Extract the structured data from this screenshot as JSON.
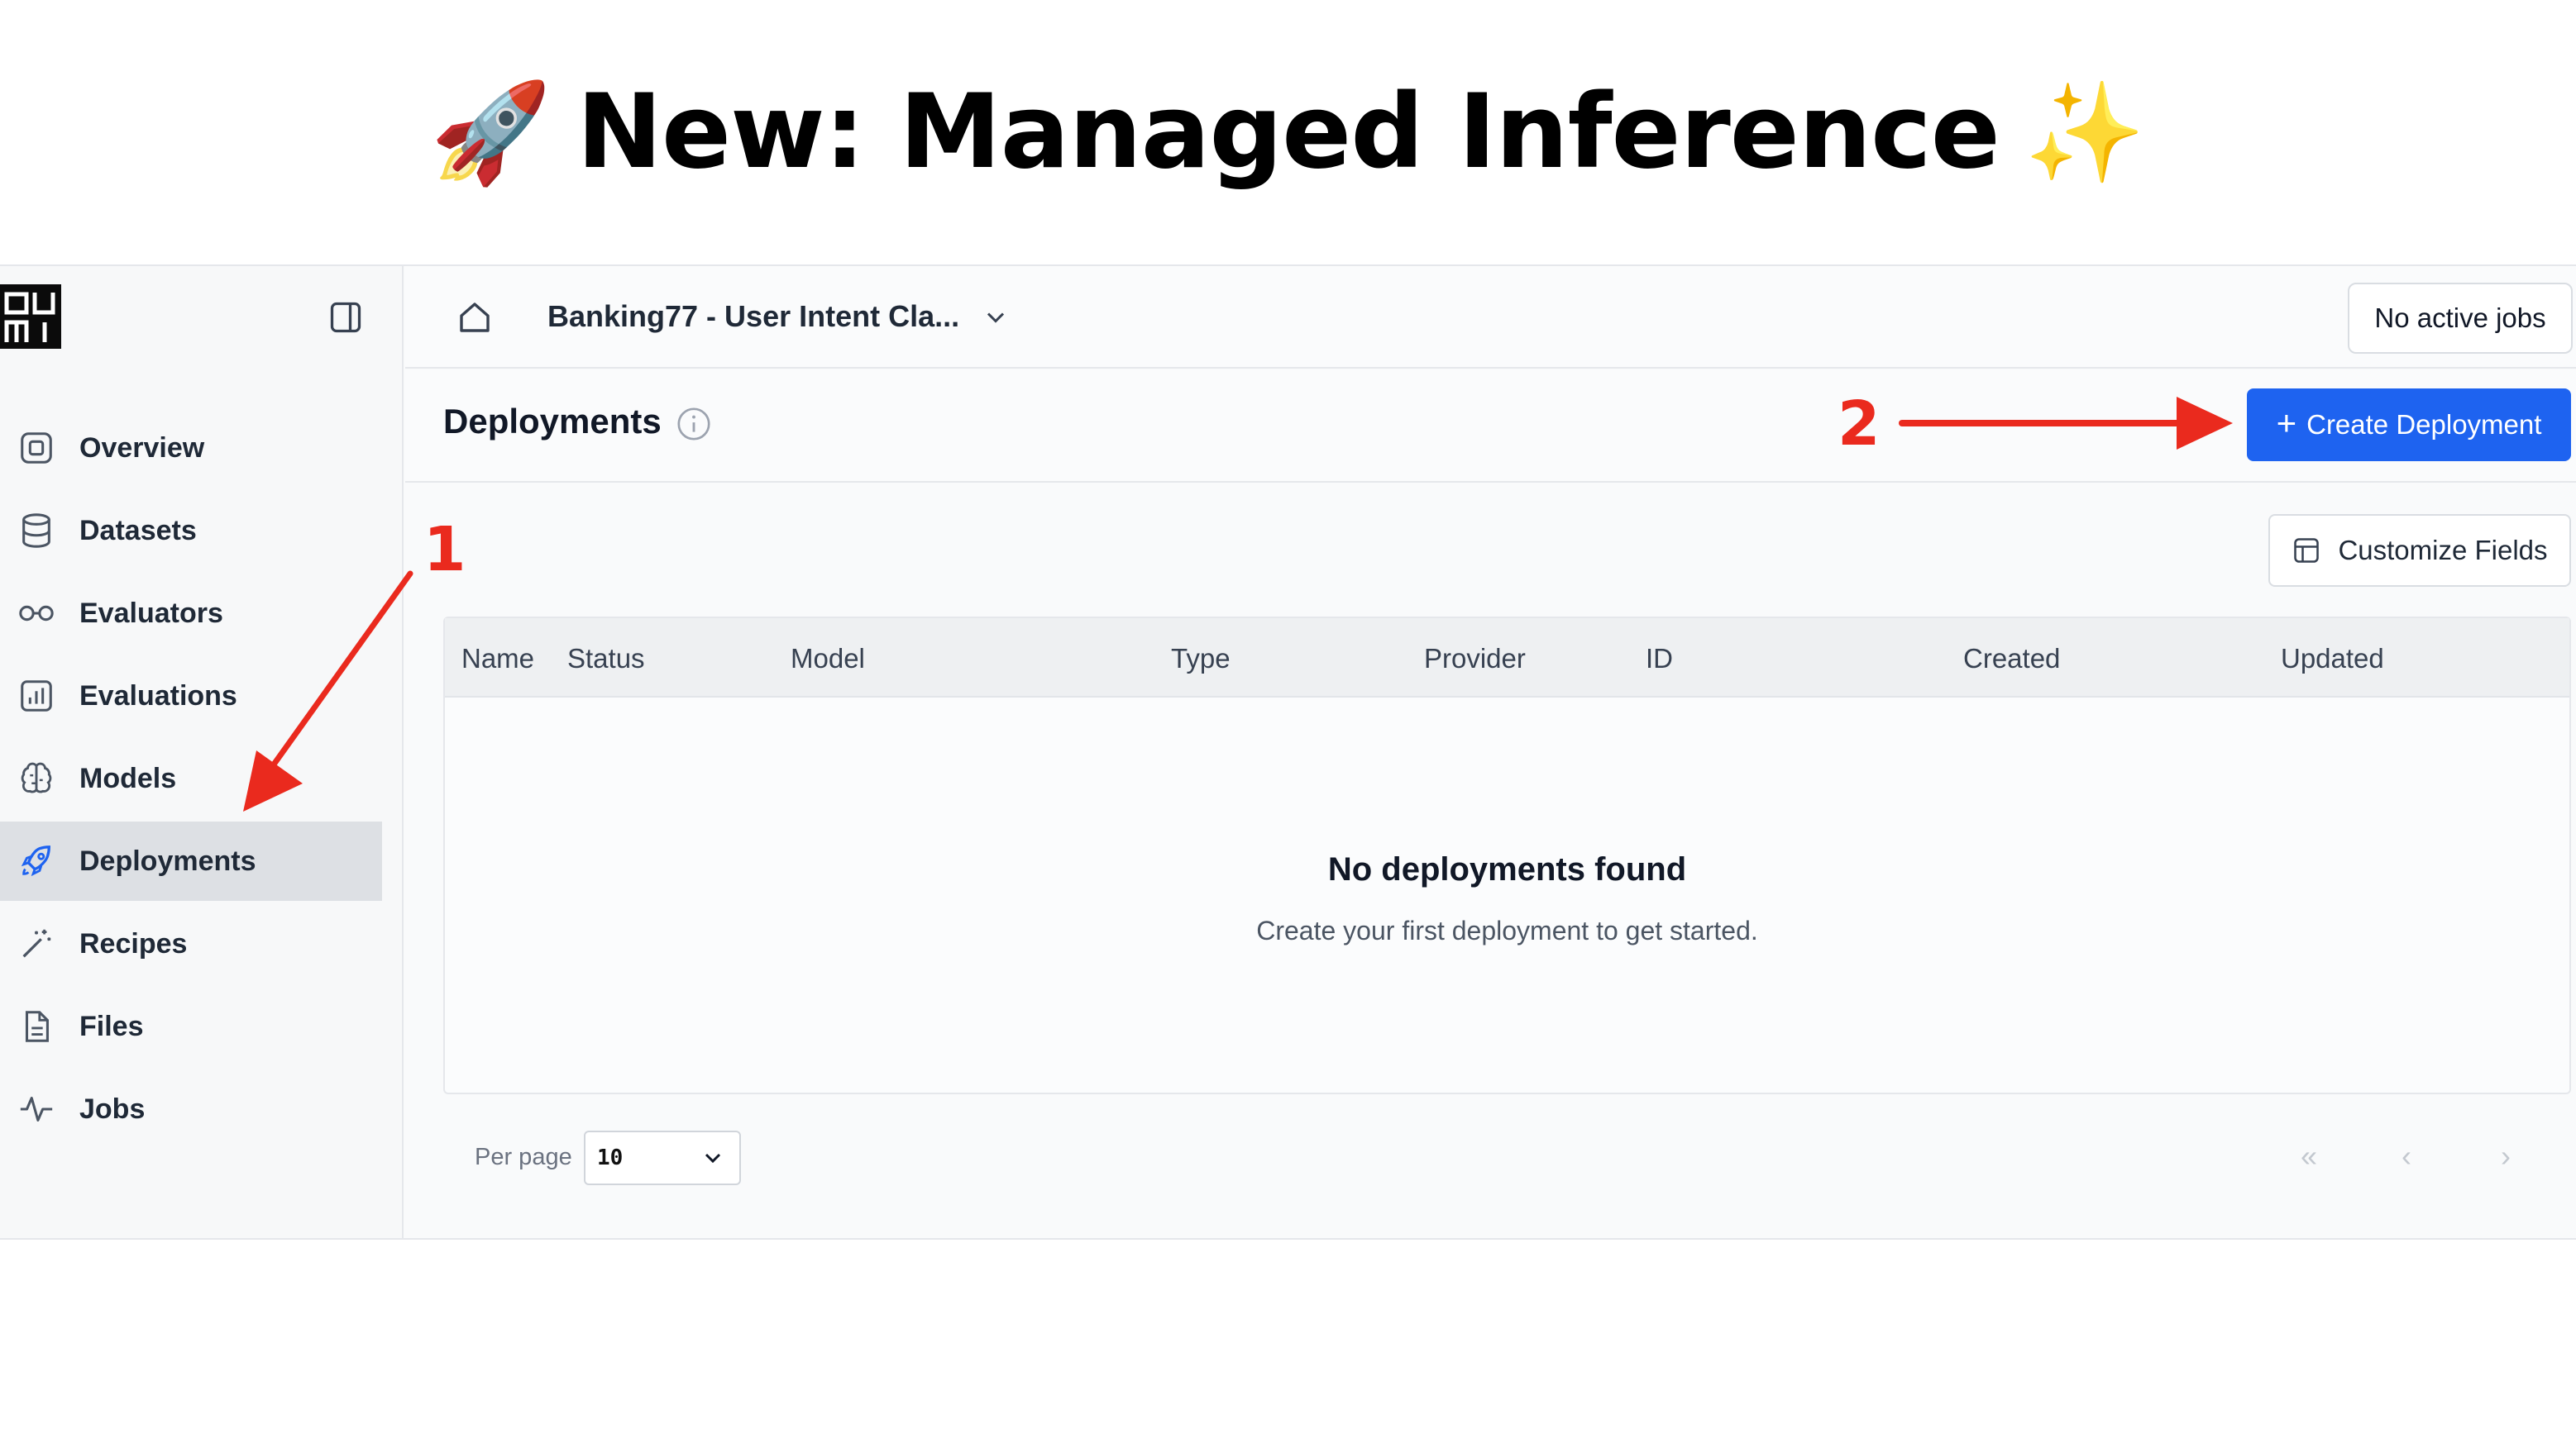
{
  "headline": {
    "title": "New: Managed Inference",
    "emoji_left": "🚀",
    "emoji_right": "✨"
  },
  "sidebar": {
    "logo": "OU\nMI",
    "items": [
      {
        "label": "Overview",
        "icon": "square-icon"
      },
      {
        "label": "Datasets",
        "icon": "database-icon"
      },
      {
        "label": "Evaluators",
        "icon": "glasses-icon"
      },
      {
        "label": "Evaluations",
        "icon": "bar-chart-icon"
      },
      {
        "label": "Models",
        "icon": "brain-icon"
      },
      {
        "label": "Deployments",
        "icon": "rocket-icon",
        "active": true
      },
      {
        "label": "Recipes",
        "icon": "wand-icon"
      },
      {
        "label": "Files",
        "icon": "file-icon"
      },
      {
        "label": "Jobs",
        "icon": "activity-icon"
      }
    ]
  },
  "topbar": {
    "project": "Banking77 - User Intent Cla...",
    "jobs_button": "No active jobs"
  },
  "header": {
    "title": "Deployments",
    "create_button": "Create Deployment",
    "customize_button": "Customize Fields"
  },
  "table": {
    "columns": [
      "Name",
      "Status",
      "Model",
      "Type",
      "Provider",
      "ID",
      "Created",
      "Updated"
    ],
    "empty_title": "No deployments found",
    "empty_subtitle": "Create your first deployment to get started."
  },
  "pagination": {
    "per_page_label": "Per page",
    "per_page_value": "10",
    "first": "«",
    "prev": "‹",
    "next": "›"
  },
  "annotations": {
    "label_1": "1",
    "label_2": "2",
    "color": "#ea2a1e"
  },
  "colors": {
    "accent": "#1e63f0",
    "active_nav": "#dde0e4"
  }
}
